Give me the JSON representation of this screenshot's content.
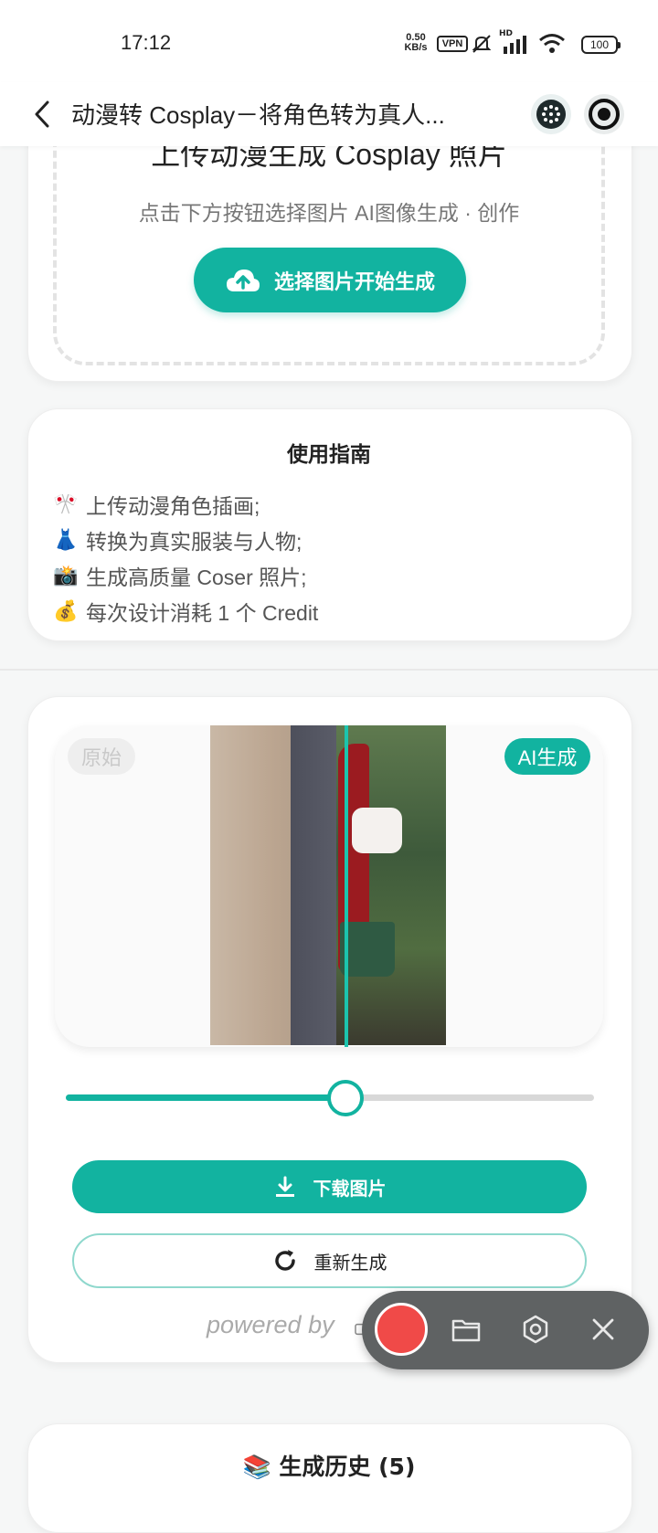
{
  "status_bar": {
    "time": "17:12",
    "speed": "0.50\nKB/s",
    "speed_value": "0.50",
    "speed_unit": "KB/s",
    "vpn": "VPN",
    "network": "HD",
    "battery": "100"
  },
  "app_bar": {
    "title": "动漫转 Cosplay－将角色转为真人..."
  },
  "upload": {
    "title": "上传动漫生成 Cosplay 照片",
    "subtitle": "点击下方按钮选择图片 AI图像生成 · 创作",
    "button_label": "选择图片开始生成"
  },
  "guide": {
    "title": "使用指南",
    "items": [
      {
        "emoji": "🎌",
        "text": "上传动漫角色插画;"
      },
      {
        "emoji": "👗",
        "text": "转换为真实服装与人物;"
      },
      {
        "emoji": "📸",
        "text": "生成高质量 Coser 照片;"
      },
      {
        "emoji": "💰",
        "text": "每次设计消耗 1 个 Credit"
      }
    ]
  },
  "result": {
    "badge_original": "原始",
    "badge_ai": "AI生成",
    "slider_value": 0.53,
    "download_label": "下载图片",
    "regenerate_label": "重新生成",
    "powered_by": "powered by",
    "powered_logo": "NE"
  },
  "history": {
    "title": "📚 生成历史 (5)"
  },
  "colors": {
    "accent": "#12b3a0",
    "recorder_bg": "#5f6263",
    "record_red": "#f04a48"
  }
}
